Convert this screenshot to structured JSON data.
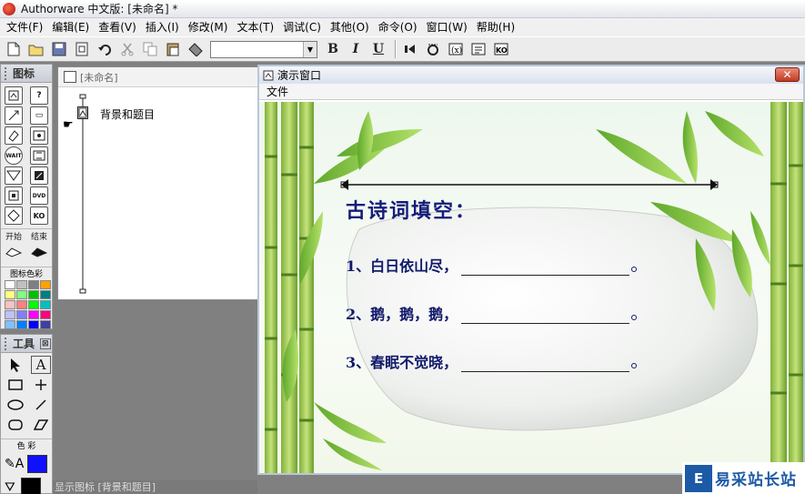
{
  "app": {
    "title": "Authorware 中文版: [未命名] *"
  },
  "menu": [
    "文件(F)",
    "编辑(E)",
    "查看(V)",
    "插入(I)",
    "修改(M)",
    "文本(T)",
    "调试(C)",
    "其他(O)",
    "命令(O)",
    "窗口(W)",
    "帮助(H)"
  ],
  "toolbar": {
    "font_value": "",
    "bold": "B",
    "italic": "I",
    "underline": "U"
  },
  "icon_palette": {
    "title": "图标",
    "start_label": "开始",
    "end_label": "结束",
    "color_label": "图标色彩",
    "swatches": [
      "#ffffff",
      "#c0c0c0",
      "#808080",
      "#ffa000",
      "#ffff80",
      "#80ff80",
      "#00c000",
      "#008080",
      "#ffc0c0",
      "#ff8080",
      "#00ff00",
      "#00c0c0",
      "#c0c0ff",
      "#8080ff",
      "#ff00ff",
      "#ff0080",
      "#80c0ff",
      "#0080ff",
      "#0000ff",
      "#4040a0"
    ]
  },
  "tools_palette": {
    "title": "工具",
    "color_label": "色 彩",
    "fill_color": "#1010ff",
    "line_color": "#000000"
  },
  "design_window": {
    "title": "[未命名]",
    "flow_icon_label": "背景和题目"
  },
  "presentation": {
    "title": "演示窗口",
    "menu_file": "文件",
    "heading": "古诗词填空：",
    "lines": [
      {
        "text": "1、白日依山尽，",
        "end": "。"
      },
      {
        "text": "2、鹅，鹅，鹅，",
        "end": "。"
      },
      {
        "text": "3、春眠不觉晓，",
        "end": "。"
      }
    ]
  },
  "statusbar": {
    "text": "显示图标 [背景和题目]"
  },
  "watermark": {
    "logo": "E",
    "name": "易采站长站"
  }
}
